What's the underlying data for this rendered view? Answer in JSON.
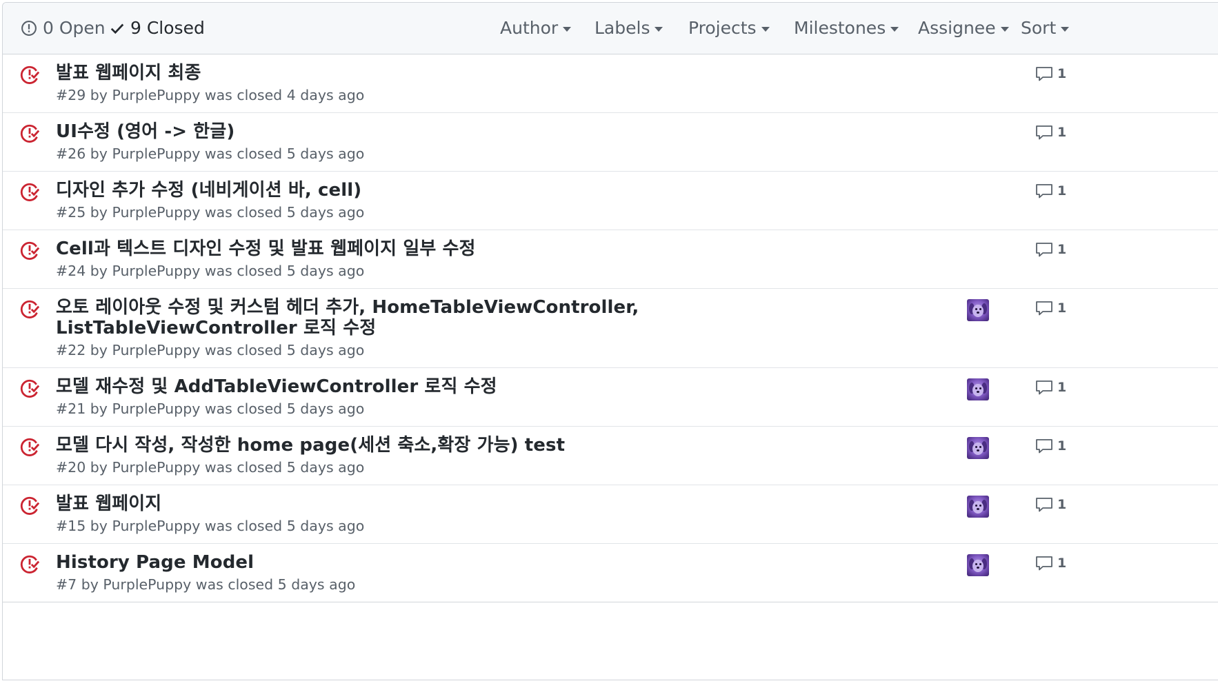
{
  "header": {
    "open_label": "0 Open",
    "closed_label": "9 Closed",
    "filters": [
      "Author",
      "Labels",
      "Projects",
      "Milestones",
      "Assignee",
      "Sort"
    ]
  },
  "colors": {
    "closed_icon": "#cb2431",
    "header_bg": "#f6f8fa",
    "border": "#e1e4e8",
    "muted_text": "#586069",
    "title_text": "#24292e"
  },
  "issues": [
    {
      "title": "발표 웹페이지 최종",
      "meta": "#29 by PurplePuppy was closed 4 days ago",
      "comments": "1",
      "has_assignee": false
    },
    {
      "title": "UI수정 (영어 -> 한글)",
      "meta": "#26 by PurplePuppy was closed 5 days ago",
      "comments": "1",
      "has_assignee": false
    },
    {
      "title": "디자인 추가 수정 (네비게이션 바, cell)",
      "meta": "#25 by PurplePuppy was closed 5 days ago",
      "comments": "1",
      "has_assignee": false
    },
    {
      "title": "Cell과 텍스트 디자인 수정 및 발표 웹페이지 일부 수정",
      "meta": "#24 by PurplePuppy was closed 5 days ago",
      "comments": "1",
      "has_assignee": false
    },
    {
      "title": "오토 레이아웃 수정 및 커스텀 헤더 추가, HomeTableViewController, ListTableViewController 로직 수정",
      "meta": "#22 by PurplePuppy was closed 5 days ago",
      "comments": "1",
      "has_assignee": true
    },
    {
      "title": "모델 재수정 및 AddTableViewController 로직 수정",
      "meta": "#21 by PurplePuppy was closed 5 days ago",
      "comments": "1",
      "has_assignee": true
    },
    {
      "title": "모델 다시 작성, 작성한 home page(세션 축소,확장 가능) test",
      "meta": "#20 by PurplePuppy was closed 5 days ago",
      "comments": "1",
      "has_assignee": true
    },
    {
      "title": "발표 웹페이지",
      "meta": "#15 by PurplePuppy was closed 5 days ago",
      "comments": "1",
      "has_assignee": true
    },
    {
      "title": "History Page Model",
      "meta": "#7 by PurplePuppy was closed 5 days ago",
      "comments": "1",
      "has_assignee": true
    }
  ]
}
